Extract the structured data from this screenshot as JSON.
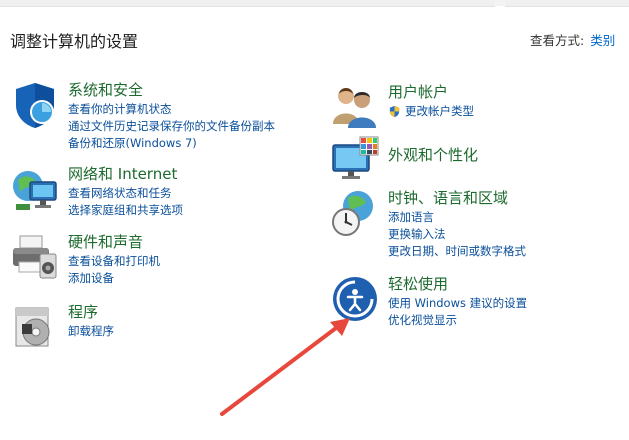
{
  "header": {
    "title": "调整计算机的设置",
    "view_by_label": "查看方式:",
    "view_by_value": "类别"
  },
  "left": {
    "system_security": {
      "title": "系统和安全",
      "links": [
        "查看你的计算机状态",
        "通过文件历史记录保存你的文件备份副本",
        "备份和还原(Windows 7)"
      ]
    },
    "network": {
      "title": "网络和 Internet",
      "links": [
        "查看网络状态和任务",
        "选择家庭组和共享选项"
      ]
    },
    "hardware": {
      "title": "硬件和声音",
      "links": [
        "查看设备和打印机",
        "添加设备"
      ]
    },
    "programs": {
      "title": "程序",
      "links": [
        "卸载程序"
      ]
    }
  },
  "right": {
    "user_accounts": {
      "title": "用户帐户",
      "links": [
        "更改帐户类型"
      ]
    },
    "appearance": {
      "title": "外观和个性化"
    },
    "clock_region": {
      "title": "时钟、语言和区域",
      "links": [
        "添加语言",
        "更换输入法",
        "更改日期、时间或数字格式"
      ]
    },
    "ease_access": {
      "title": "轻松使用",
      "links": [
        "使用 Windows 建议的设置",
        "优化视觉显示"
      ]
    }
  },
  "colors": {
    "title_green": "#1d6a2e",
    "link_blue": "#0a4f9a",
    "arrow_red": "#e8473b"
  }
}
